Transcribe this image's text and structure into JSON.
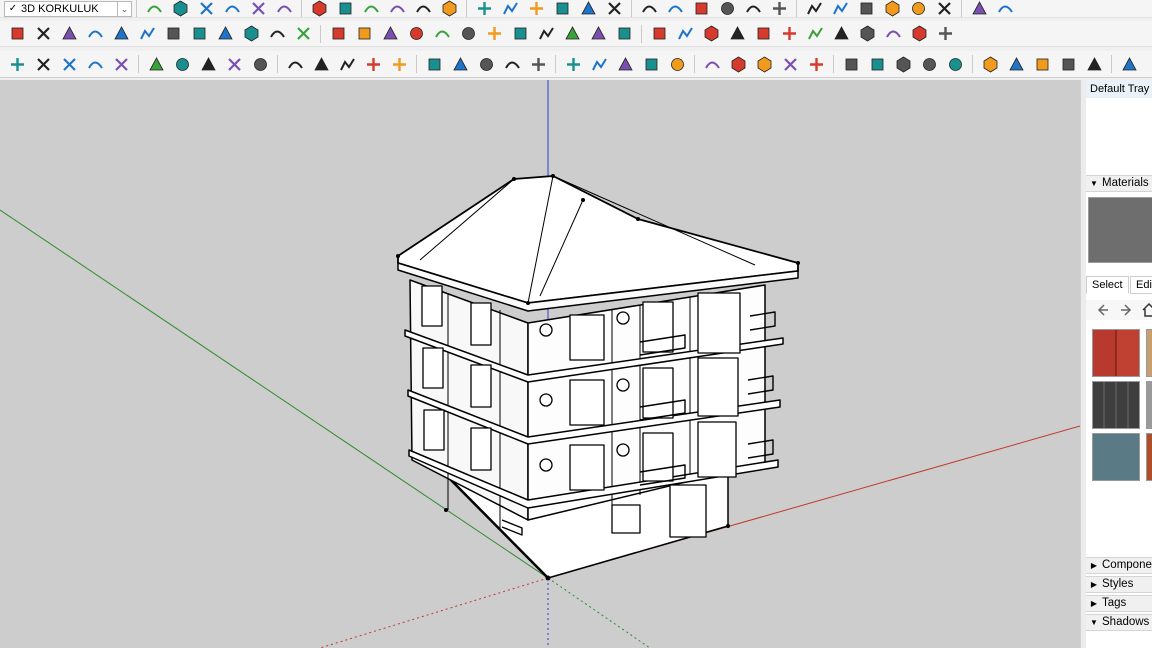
{
  "scene": {
    "selected": "3D KORKULUK",
    "check": "✓",
    "arrow": "⌄"
  },
  "tray": {
    "title": "Default Tray",
    "materials_label": "Materials",
    "tabs": [
      "Select",
      "Edit"
    ],
    "panels": [
      "Components",
      "Styles",
      "Tags",
      "Shadows"
    ],
    "materials_expanded": "▼",
    "collapsed": "▶"
  },
  "colors": {
    "viewport_bg": "#cdcdcd",
    "axis_red": "#c0392b",
    "axis_green": "#2e8b2e",
    "axis_blue": "#2b3fd1",
    "accent_red": "#d63a2c",
    "accent_orange": "#f09a1e",
    "accent_blue": "#1f74c9",
    "accent_green": "#3aa23a"
  },
  "toolbar_icons": {
    "row1": [
      "select-icon",
      "eraser-icon",
      "pencil-icon",
      "arc-icon",
      "paint-bucket-icon",
      "push-pull-icon",
      "follow-me-icon",
      "move-icon",
      "rotate-icon",
      "scale-icon",
      "tape-measure-icon",
      "text-icon",
      "paint-icon",
      "orbit-icon",
      "pan-icon",
      "zoom-icon",
      "zoom-extents-icon",
      "section-icon",
      "walk-icon",
      "look-around-icon",
      "position-camera-icon",
      "iso-view-icon",
      "top-view-icon",
      "front-view-icon",
      "right-view-icon",
      "back-view-icon",
      "left-view-icon",
      "xray-icon",
      "wireframe-icon",
      "hidden-line-icon",
      "shaded-icon",
      "texture-icon"
    ],
    "row2": [
      "solid-union-icon",
      "solid-intersect-icon",
      "solid-trim-icon",
      "solid-split-icon",
      "subtract-icon",
      "shell-icon",
      "curve-icon",
      "rect-icon",
      "wall-icon",
      "window-icon",
      "door-icon",
      "stair-icon",
      "railing-icon",
      "bezier-icon",
      "move-x-icon",
      "move-y-icon",
      "move-z-icon",
      "cone-icon",
      "pyramid-icon",
      "triangle-icon",
      "fillet-icon",
      "chamfer-icon",
      "offset-icon",
      "axes-icon",
      "box-icon",
      "undo-loop-icon",
      "group-icon",
      "component-icon",
      "explode-icon",
      "texture-tile-icon",
      "grid-icon",
      "grid2-icon",
      "scatter-icon",
      "lasso-icon",
      "array-icon",
      "layers-icon"
    ],
    "row3": [
      "extension-icon",
      "refresh-icon",
      "export-icon",
      "add-icon",
      "tree-icon",
      "terrain-icon",
      "checker-icon",
      "cloud-icon",
      "settings-icon",
      "mail-icon",
      "info-icon",
      "draw-path-icon",
      "curve2-icon",
      "tool-icon",
      "cut-icon",
      "knot-icon",
      "loop-icon",
      "bend-icon",
      "cube-icon",
      "sphere-icon",
      "twist-icon",
      "angle-icon",
      "angle2-icon",
      "line-icon",
      "sweep-icon",
      "ruler-icon",
      "prism-icon",
      "wave-icon",
      "mesh-icon",
      "hand-icon",
      "shape-icon",
      "leaf-icon",
      "flatten-icon",
      "skew-icon",
      "fan-icon",
      "fan2-icon",
      "cylinder-icon",
      "stair2-icon",
      "wall2-icon",
      "bevel-icon",
      "fold-icon"
    ]
  }
}
